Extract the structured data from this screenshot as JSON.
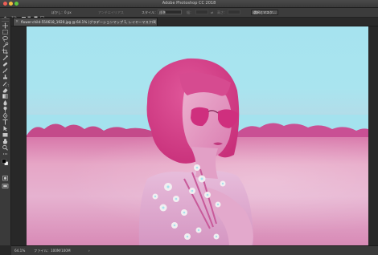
{
  "window": {
    "title": "Adobe Photoshop CC 2018"
  },
  "options_bar": {
    "tool_icon": "marquee-icon",
    "feather_label": "ぼかし：0 px",
    "anti_alias_label": "アンチエイリアス",
    "style_label": "スタイル：",
    "style_value": "標準",
    "width_label": "幅：",
    "height_label": "高さ：",
    "select_mask_button": "選択とマスク..."
  },
  "tools": [
    {
      "name": "move-tool",
      "icon": "move-icon"
    },
    {
      "name": "marquee-tool",
      "icon": "rect-marquee-icon"
    },
    {
      "name": "lasso-tool",
      "icon": "lasso-icon"
    },
    {
      "name": "quick-select-tool",
      "icon": "quick-select-icon"
    },
    {
      "name": "crop-tool",
      "icon": "crop-icon"
    },
    {
      "name": "eyedropper-tool",
      "icon": "eyedropper-icon"
    },
    {
      "name": "healing-tool",
      "icon": "bandage-icon"
    },
    {
      "name": "brush-tool",
      "icon": "brush-icon"
    },
    {
      "name": "clone-stamp-tool",
      "icon": "stamp-icon"
    },
    {
      "name": "history-brush-tool",
      "icon": "history-brush-icon"
    },
    {
      "name": "eraser-tool",
      "icon": "eraser-icon"
    },
    {
      "name": "gradient-tool",
      "icon": "gradient-icon"
    },
    {
      "name": "blur-tool",
      "icon": "droplet-icon"
    },
    {
      "name": "dodge-tool",
      "icon": "dodge-icon"
    },
    {
      "name": "pen-tool",
      "icon": "pen-icon"
    },
    {
      "name": "type-tool",
      "icon": "type-icon"
    },
    {
      "name": "path-select-tool",
      "icon": "arrow-icon"
    },
    {
      "name": "shape-tool",
      "icon": "rectangle-icon"
    },
    {
      "name": "hand-tool",
      "icon": "hand-icon"
    },
    {
      "name": "zoom-tool",
      "icon": "magnifier-icon"
    },
    {
      "name": "more-tools",
      "icon": "ellipsis-icon"
    },
    {
      "name": "color-swatches",
      "icon": "color-swatch-icon"
    },
    {
      "name": "quick-mask",
      "icon": "quick-mask-icon"
    },
    {
      "name": "screen-mode",
      "icon": "screen-mode-icon"
    }
  ],
  "document_tab": {
    "label": "flower-child-550618_1920.jpg @ 64.1% (グラデーションマップ 1, レイヤーマスク/8) *",
    "close_icon": "close-icon"
  },
  "status_bar": {
    "zoom": "64.1%",
    "file_info": "ファイル：100M/100M",
    "arrow": "›"
  },
  "colors": {
    "highlight": "#a6e3ef",
    "shadow": "#d63a86",
    "ui_dark": "#282828",
    "ui_panel": "#3a3a3a"
  }
}
